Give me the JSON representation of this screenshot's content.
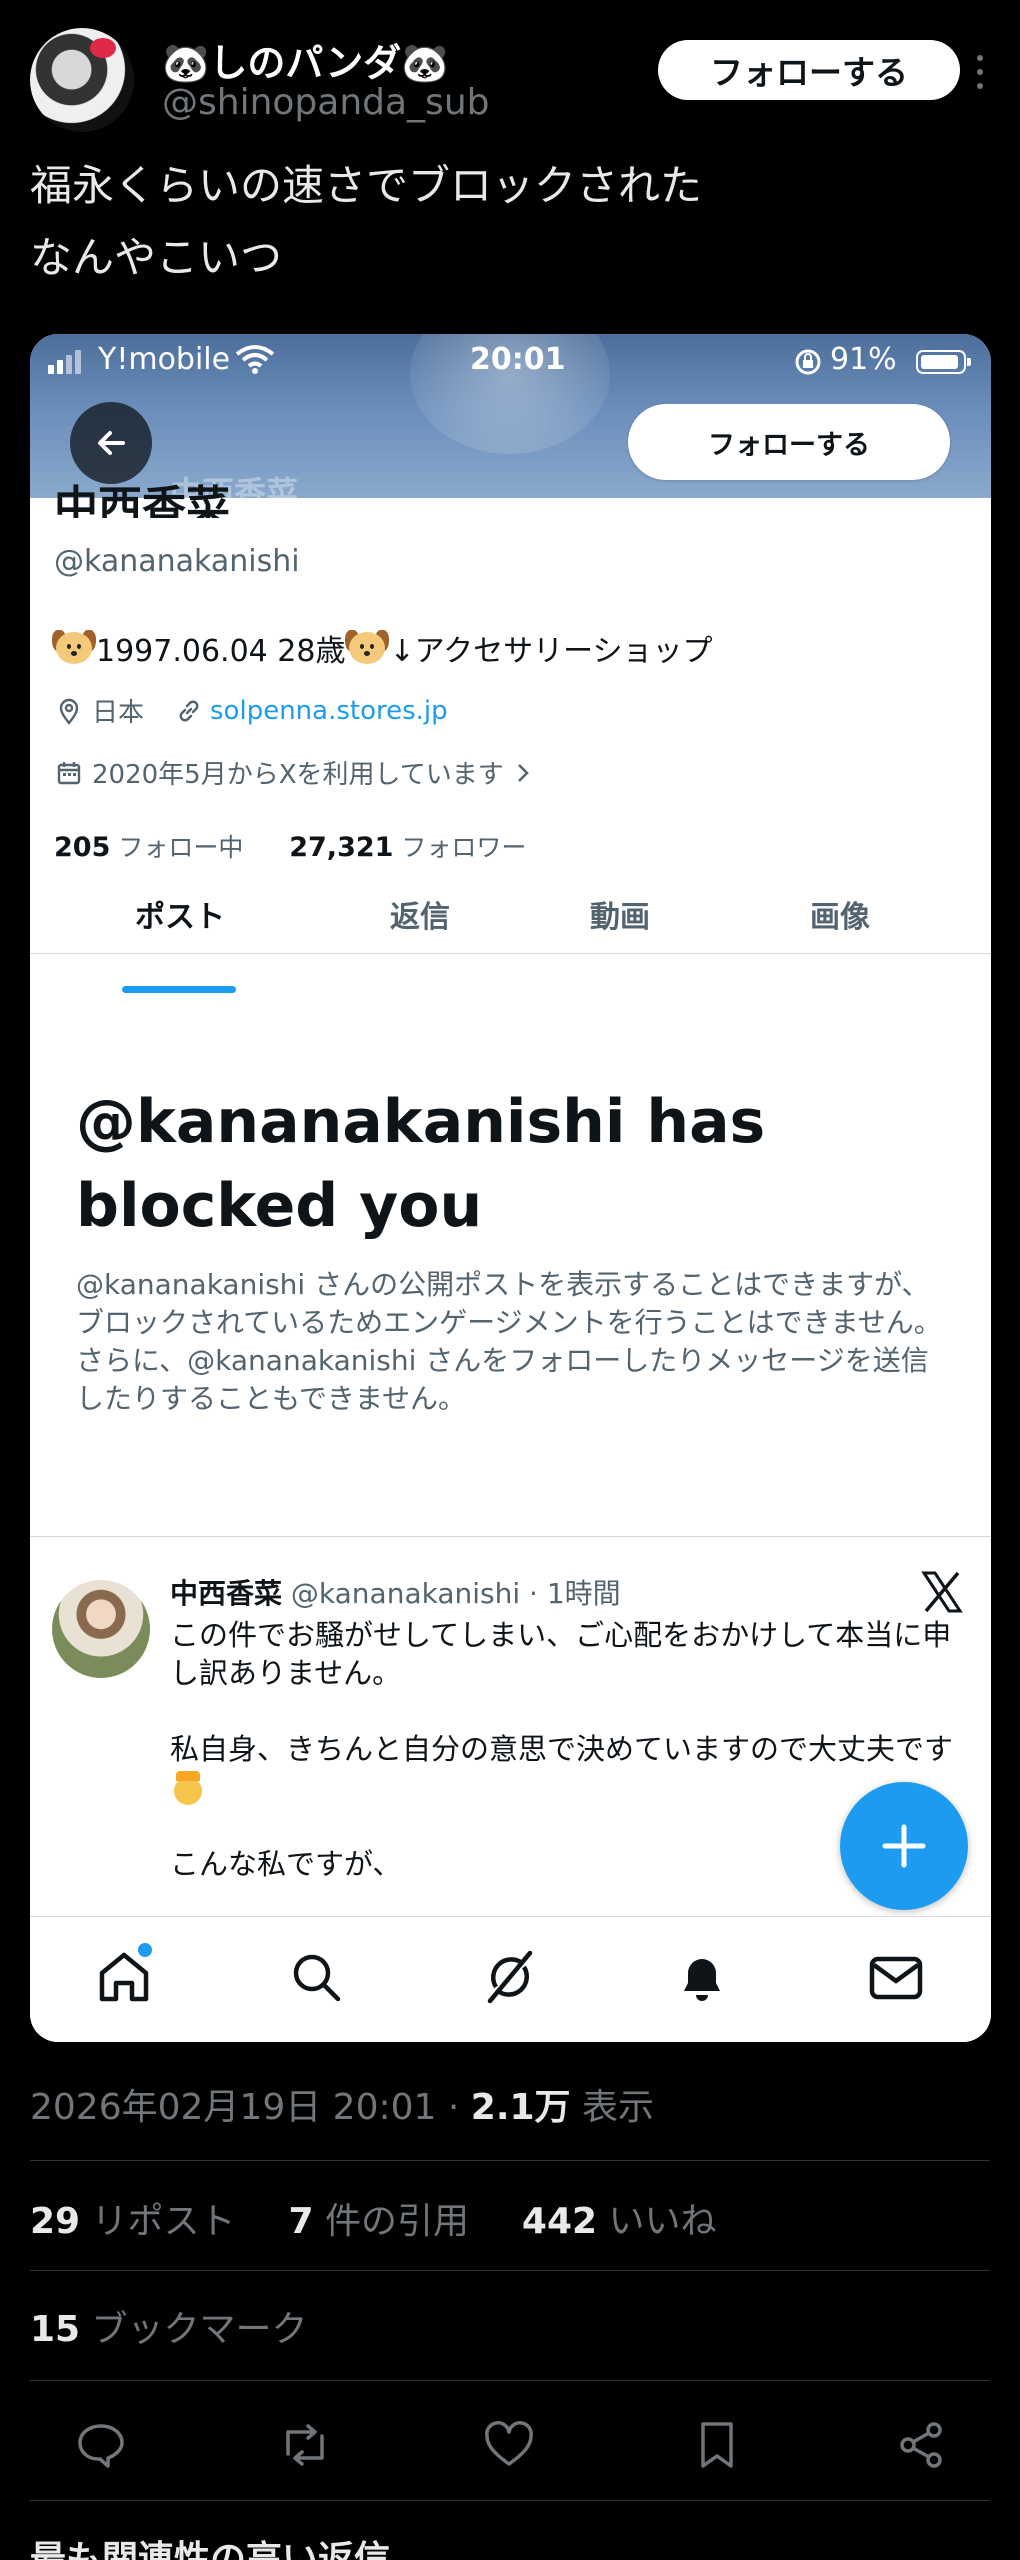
{
  "tweet": {
    "display_name": "🐼しのパンダ🐼",
    "handle": "@shinopanda_sub",
    "follow_label": "フォローする",
    "text_line1": "福永くらいの速さでブロックされた",
    "text_line2": "なんやこいつ",
    "timestamp": "2026年02月19日 20:01 · ",
    "views_count": "2.1万",
    "views_label": " 表示",
    "reposts_count": "29",
    "reposts_label": " リポスト",
    "quotes_count": "7",
    "quotes_label": " 件の引用",
    "likes_count": "442",
    "likes_label": " いいね",
    "bookmarks_count": "15",
    "bookmarks_label": " ブックマーク",
    "more_replies_label": "最も関連性の高い返信 ⌄"
  },
  "screenshot": {
    "status": {
      "carrier": "Y!mobile",
      "time": "20:01",
      "battery": "91%"
    },
    "follow_label": "フォローする",
    "banner_ghost_text": "中西香菜",
    "profile": {
      "name": "中西香菜",
      "handle": "@kananakanishi",
      "bio": "1997.06.04 28歳",
      "bio_suffix": " ↓アクセサリーショップ",
      "location": "日本",
      "link": "solpenna.stores.jp",
      "joined": "2020年5月からXを利用しています",
      "following_count": "205",
      "following_label": " フォロー中",
      "followers_count": "27,321",
      "followers_label": " フォロワー"
    },
    "tabs": [
      "ポスト",
      "返信",
      "動画",
      "画像"
    ],
    "block": {
      "title": "@kananakanishi has blocked you",
      "description": "@kananakanishi さんの公開ポストを表示することはできますが、ブロックされているためエンゲージメントを行うことはできません。さらに、@kananakanishi さんをフォローしたりメッセージを送信したりすることもできません。"
    },
    "post": {
      "author": "中西香菜",
      "meta": " @kananakanishi · 1時間",
      "line1": "この件でお騒がせしてしまい、ご心配をおかけして本当に申し訳ありません。",
      "line2": "私自身、きちんと自分の意思で決めていますので大丈夫です",
      "line3": "こんな私ですが、"
    }
  },
  "colors": {
    "accent": "#1d9bf0",
    "background": "#000000",
    "muted": "#71767b"
  },
  "icons": [
    "more-icon",
    "back-arrow-icon",
    "location-icon",
    "link-icon",
    "calendar-icon",
    "x-logo-icon",
    "plus-icon",
    "home-icon",
    "search-icon",
    "grok-icon",
    "bell-icon",
    "mail-icon",
    "reply-icon",
    "repost-icon",
    "like-icon",
    "bookmark-icon",
    "share-icon"
  ]
}
